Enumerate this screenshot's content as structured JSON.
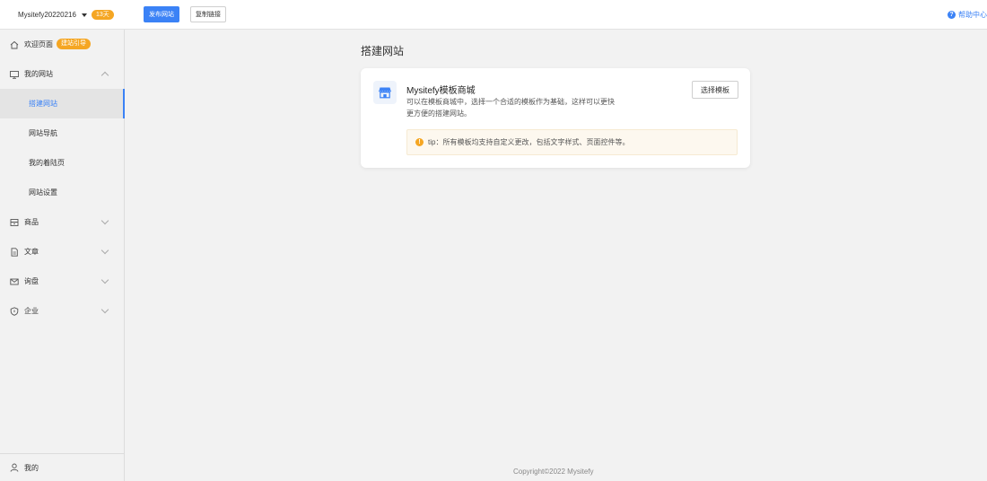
{
  "header": {
    "site_name": "Mysitefy20220216",
    "days_badge": "13天",
    "publish_label": "发布网站",
    "copy_link_label": "复制链接",
    "help_label": "帮助中心"
  },
  "sidebar": {
    "welcome": {
      "label": "欢迎页面",
      "badge": "建站引导"
    },
    "my_site": {
      "label": "我的网站"
    },
    "sub_items": [
      {
        "label": "搭建网站"
      },
      {
        "label": "网站导航"
      },
      {
        "label": "我的着陆页"
      },
      {
        "label": "网站设置"
      }
    ],
    "goods": {
      "label": "商品"
    },
    "articles": {
      "label": "文章"
    },
    "inquiry": {
      "label": "询盘"
    },
    "company": {
      "label": "企业"
    },
    "me": {
      "label": "我的"
    }
  },
  "main": {
    "title": "搭建网站",
    "card": {
      "title": "Mysitefy模板商城",
      "description": "可以在模板商城中，选择一个合适的模板作为基础，这样可以更快更方便的搭建网站。",
      "select_button": "选择模板",
      "tip": "tip：所有模板均支持自定义更改，包括文字样式、页面控件等。"
    }
  },
  "footer": {
    "copyright": "Copyright©2022 Mysitefy"
  },
  "colors": {
    "accent": "#3b82f6",
    "badge": "#f5a623"
  }
}
